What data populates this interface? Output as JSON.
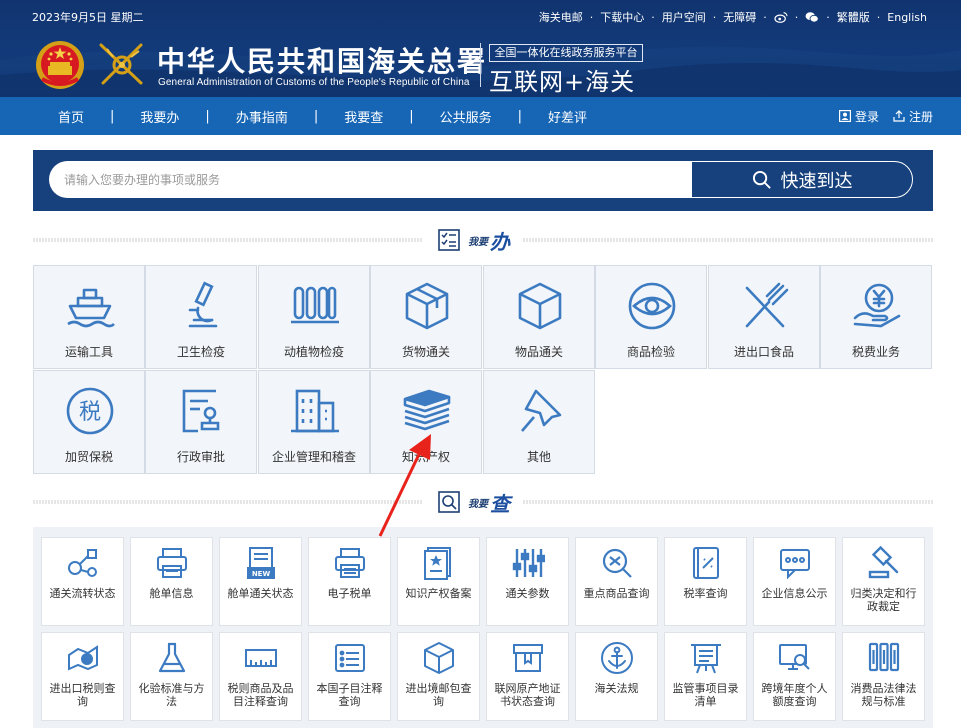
{
  "header": {
    "date": "2023年9月5日  星期二",
    "top_links": [
      "海关电邮",
      "下载中心",
      "用户空间",
      "无障碍"
    ],
    "lang_traditional": "繁體版",
    "lang_english": "English",
    "title_cn": "中华人民共和国海关总署",
    "title_en": "General Administration of Customs of the People's Republic of China",
    "platform_box": "全国一体化在线政务服务平台",
    "platform_name": "互联网+海关"
  },
  "nav": {
    "items": [
      "首页",
      "我要办",
      "办事指南",
      "我要查",
      "公共服务",
      "好差评"
    ],
    "login": "登录",
    "register": "注册"
  },
  "search": {
    "placeholder": "请输入您要办理的事项或服务",
    "button": "快速到达"
  },
  "sections": {
    "ban_small": "我要",
    "ban_big": "办",
    "cha_small": "我要",
    "cha_big": "查"
  },
  "ban_items": [
    {
      "label": "运输工具",
      "icon": "ship-icon"
    },
    {
      "label": "卫生检疫",
      "icon": "microscope-icon"
    },
    {
      "label": "动植物检疫",
      "icon": "test-tubes-icon"
    },
    {
      "label": "货物通关",
      "icon": "package-icon"
    },
    {
      "label": "物品通关",
      "icon": "box-icon"
    },
    {
      "label": "商品检验",
      "icon": "eye-icon"
    },
    {
      "label": "进出口食品",
      "icon": "fork-knife-icon"
    },
    {
      "label": "税费业务",
      "icon": "yen-hand-icon"
    },
    {
      "label": "加贸保税",
      "icon": "tax-icon"
    },
    {
      "label": "行政审批",
      "icon": "approval-stamp-icon"
    },
    {
      "label": "企业管理和稽查",
      "icon": "building-icon"
    },
    {
      "label": "知识产权",
      "icon": "books-icon"
    },
    {
      "label": "其他",
      "icon": "pushpin-icon"
    }
  ],
  "cha_items": [
    {
      "label": "通关流转状态",
      "icon": "flow-icon"
    },
    {
      "label": "舱单信息",
      "icon": "printer-icon"
    },
    {
      "label": "舱单通关状态",
      "icon": "new-doc-icon"
    },
    {
      "label": "电子税单",
      "icon": "printer-doc-icon"
    },
    {
      "label": "知识产权备案",
      "icon": "certificate-icon"
    },
    {
      "label": "通关参数",
      "icon": "sliders-icon"
    },
    {
      "label": "重点商品查询",
      "icon": "search-item-icon"
    },
    {
      "label": "税率查询",
      "icon": "rate-book-icon"
    },
    {
      "label": "企业信息公示",
      "icon": "chat-dots-icon"
    },
    {
      "label": "归类决定和行政裁定",
      "icon": "gavel-icon"
    },
    {
      "label": "进出口税则查询",
      "icon": "tariff-icon"
    },
    {
      "label": "化验标准与方法",
      "icon": "flask-icon"
    },
    {
      "label": "税则商品及品目注释查询",
      "icon": "ruler-icon"
    },
    {
      "label": "本国子目注释查询",
      "icon": "list-doc-icon"
    },
    {
      "label": "进出境邮包查询",
      "icon": "parcel-icon"
    },
    {
      "label": "联网原产地证书状态查询",
      "icon": "origin-box-icon"
    },
    {
      "label": "海关法规",
      "icon": "anchor-icon"
    },
    {
      "label": "监管事项目录清单",
      "icon": "board-icon"
    },
    {
      "label": "跨境年度个人额度查询",
      "icon": "monitor-search-icon"
    },
    {
      "label": "消费品法律法规与标准",
      "icon": "columns-icon"
    }
  ],
  "colors": {
    "header_bg": "#123a7a",
    "nav_bg": "#1766b6",
    "search_bg": "#17417d",
    "icon_blue": "#3c7bc1",
    "arrow_red": "#e8231c"
  }
}
